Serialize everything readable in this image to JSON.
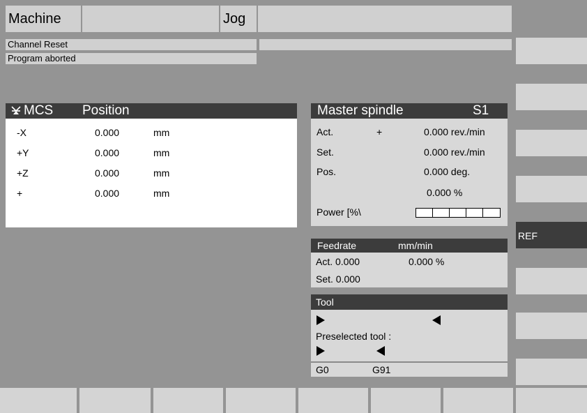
{
  "header": {
    "area": "Machine",
    "mode": "Jog"
  },
  "status": {
    "line1": "Channel Reset",
    "line2": "Program aborted"
  },
  "mcs": {
    "coord_system": "MCS",
    "position_header": "Position",
    "icon": "machine-zero-icon",
    "rows": [
      {
        "axis": "-X",
        "value": "0.000",
        "unit": "mm"
      },
      {
        "axis": "+Y",
        "value": "0.000",
        "unit": "mm"
      },
      {
        "axis": "+Z",
        "value": "0.000",
        "unit": "mm"
      },
      {
        "axis": "+",
        "value": "0.000",
        "unit": "mm"
      }
    ]
  },
  "spindle": {
    "title": "Master spindle",
    "id": "S1",
    "act_label": "Act.",
    "act_sign": "+",
    "act_value": "0.000 rev./min",
    "set_label": "Set.",
    "set_value": "0.000 rev./min",
    "pos_label": "Pos.",
    "pos_value": "0.000 deg.",
    "override": "0.000  %",
    "power_label": "Power [%\\",
    "power_level": 0
  },
  "feedrate": {
    "title": "Feedrate",
    "unit": "mm/min",
    "act_line": "Act. 0.000",
    "override": "0.000 %",
    "set_line": "Set. 0.000"
  },
  "tool": {
    "title": "Tool",
    "preselected_label": "Preselected tool :",
    "gcode1": "G0",
    "gcode2": "G91"
  },
  "softkeys": {
    "ref_label": "REF"
  },
  "colors": {
    "background": "#949494",
    "pane": "#d8d8d8",
    "header_bar": "#3c3c3c",
    "white_panel": "#ffffff"
  }
}
